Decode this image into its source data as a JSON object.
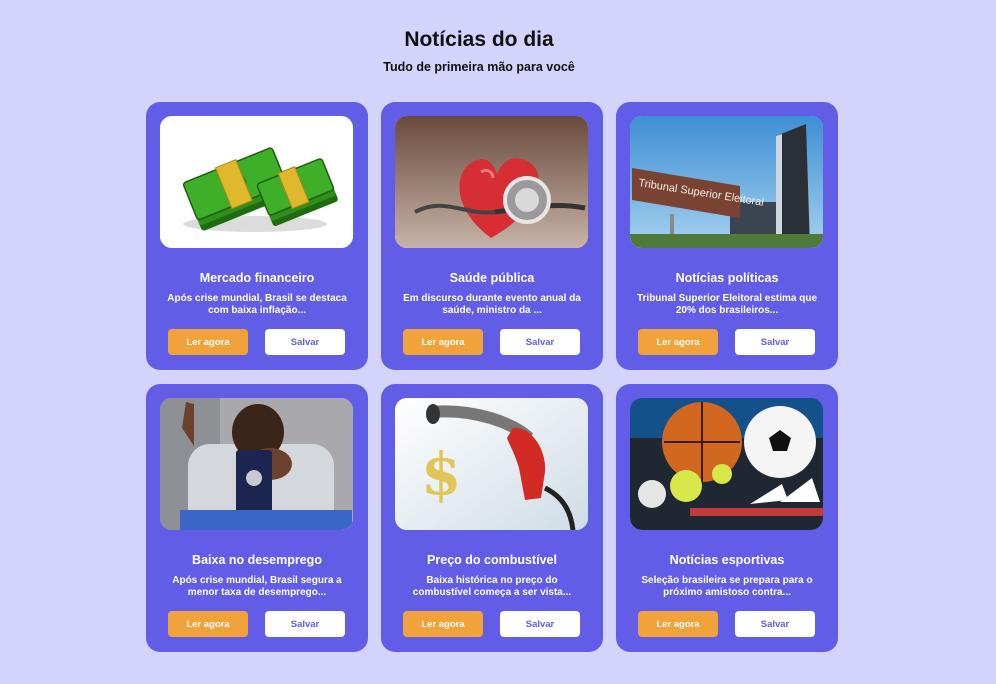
{
  "header": {
    "title": "Notícias do dia",
    "subtitle": "Tudo de primeira mão para você"
  },
  "colors": {
    "background": "#d4d3fb",
    "card": "#625de6",
    "read_button": "#f2a23a",
    "save_button": "#ffffff"
  },
  "cards": [
    {
      "image": "money-stacks-image",
      "title": "Mercado financeiro",
      "description": "Após crise mundial, Brasil se destaca com baixa inflação...",
      "read_label": "Ler agora",
      "save_label": "Salvar"
    },
    {
      "image": "heart-stethoscope-image",
      "title": "Saúde pública",
      "description": "Em discurso durante evento anual da saúde, ministro da ...",
      "read_label": "Ler agora",
      "save_label": "Salvar"
    },
    {
      "image": "electoral-court-building-image",
      "image_sign_text": "Tribunal Superior Eleitoral",
      "title": "Notícias políticas",
      "description": "Tribunal Superior Eleitoral estima que 20% dos brasileiros...",
      "read_label": "Ler agora",
      "save_label": "Salvar"
    },
    {
      "image": "worried-man-work-card-image",
      "title": "Baixa no desemprego",
      "description": "Após crise mundial, Brasil segura a menor taxa de desemprego...",
      "read_label": "Ler agora",
      "save_label": "Salvar"
    },
    {
      "image": "fuel-nozzle-dollar-image",
      "title": "Preço do combustível",
      "description": "Baixa histórica no preço do combustível começa a ser vista...",
      "read_label": "Ler agora",
      "save_label": "Salvar"
    },
    {
      "image": "sports-balls-image",
      "title": "Notícias esportivas",
      "description": "Seleção brasileira se prepara para o próximo amistoso contra...",
      "read_label": "Ler agora",
      "save_label": "Salvar"
    }
  ]
}
